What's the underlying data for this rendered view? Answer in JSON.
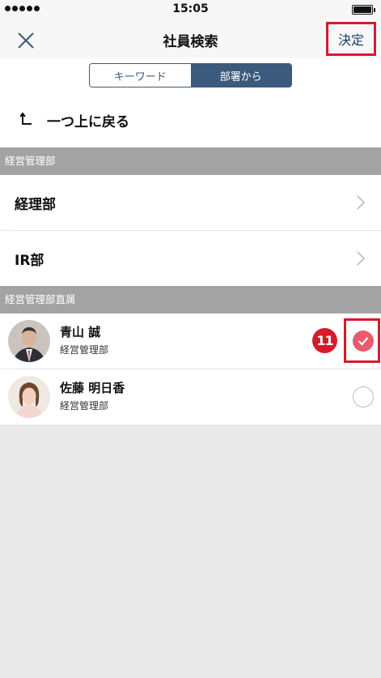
{
  "status_bar": {
    "time": "15:05",
    "signal_icon": "signal-dots-icon",
    "battery_icon": "battery-icon"
  },
  "nav": {
    "title": "社員検索",
    "done_label": "決定",
    "close_icon": "close-icon"
  },
  "segments": [
    {
      "label": "キーワード",
      "active": false
    },
    {
      "label": "部署から",
      "active": true
    }
  ],
  "back": {
    "label": "一つ上に戻る",
    "icon": "up-arrow-icon"
  },
  "current_department": {
    "header": "経営管理部",
    "subdepartments": [
      {
        "label": "経理部"
      },
      {
        "label": "IR部"
      }
    ]
  },
  "direct_members": {
    "header": "経営管理部直属",
    "people": [
      {
        "name": "青山 誠",
        "department": "経営管理部",
        "selected": true,
        "badge": "11"
      },
      {
        "name": "佐藤 明日香",
        "department": "経営管理部",
        "selected": false
      }
    ]
  },
  "colors": {
    "accent": "#3c5a7c",
    "highlight": "#d61b2b",
    "check": "#e95b6c"
  }
}
